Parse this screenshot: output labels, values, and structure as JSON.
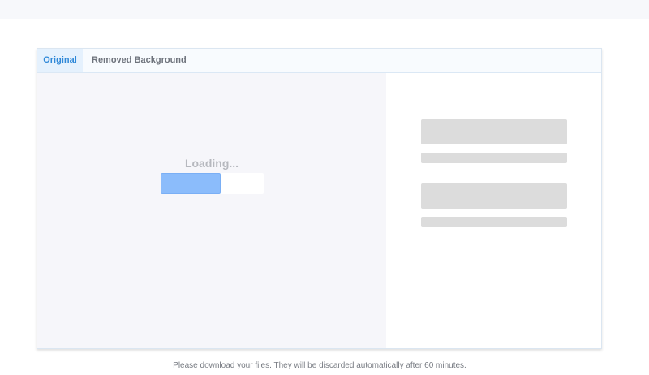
{
  "tabs": [
    {
      "label": "Original",
      "active": true
    },
    {
      "label": "Removed Background",
      "active": false
    }
  ],
  "preview": {
    "status_text": "Loading...",
    "progress_percent": 58
  },
  "footer": {
    "notice": "Please download your files. They will be discarded automatically after 60 minutes."
  },
  "colors": {
    "accent": "#2f88d8",
    "progress_fill": "#8bbcfb",
    "skeleton": "#dcdcdc"
  }
}
